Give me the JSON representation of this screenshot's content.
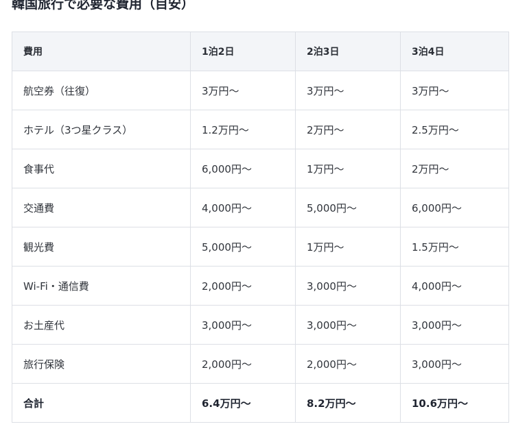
{
  "title": "韓国旅行で必要な費用（目安）",
  "table": {
    "headers": [
      "費用",
      "1泊2日",
      "2泊3日",
      "3泊4日"
    ],
    "rows": [
      [
        "航空券（往復）",
        "3万円〜",
        "3万円〜",
        "3万円〜"
      ],
      [
        "ホテル（3つ星クラス）",
        "1.2万円〜",
        "2万円〜",
        "2.5万円〜"
      ],
      [
        "食事代",
        "6,000円〜",
        "1万円〜",
        "2万円〜"
      ],
      [
        "交通費",
        "4,000円〜",
        "5,000円〜",
        "6,000円〜"
      ],
      [
        "観光費",
        "5,000円〜",
        "1万円〜",
        "1.5万円〜"
      ],
      [
        "Wi-Fi・通信費",
        "2,000円〜",
        "3,000円〜",
        "4,000円〜"
      ],
      [
        "お土産代",
        "3,000円〜",
        "3,000円〜",
        "3,000円〜"
      ],
      [
        "旅行保険",
        "2,000円〜",
        "2,000円〜",
        "3,000円〜"
      ]
    ],
    "total": [
      "合計",
      "6.4万円〜",
      "8.2万円〜",
      "10.6万円〜"
    ]
  }
}
